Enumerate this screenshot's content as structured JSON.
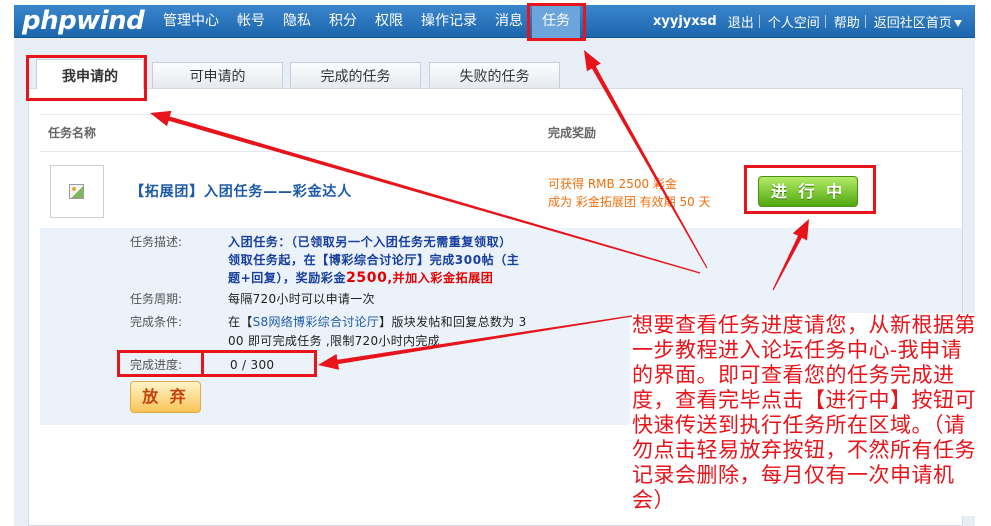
{
  "nav": {
    "logo": "phpwind",
    "items": [
      {
        "label": "管理中心"
      },
      {
        "label": "帐号"
      },
      {
        "label": "隐私"
      },
      {
        "label": "积分"
      },
      {
        "label": "权限"
      },
      {
        "label": "操作记录"
      },
      {
        "label": "消息"
      },
      {
        "label": "任务",
        "active": true
      }
    ],
    "user": "xyyjyxsd",
    "links": [
      "退出",
      "个人空间",
      "帮助",
      "返回社区首页"
    ],
    "dropdown_icon": "chevron-down-icon"
  },
  "tabs": [
    {
      "label": "我申请的",
      "active": true
    },
    {
      "label": "可申请的"
    },
    {
      "label": "完成的任务"
    },
    {
      "label": "失败的任务"
    }
  ],
  "table": {
    "col_name": "任务名称",
    "col_reward": "完成奖励"
  },
  "task": {
    "image_icon": "broken-image-icon",
    "title": "【拓展团】入团任务——彩金达人",
    "reward_line1": "可获得 RMB 2500 彩金",
    "reward_line2": "成为 彩金拓展团 有效期 50 天",
    "status_button": "进 行 中",
    "details": {
      "desc_label": "任务描述:",
      "desc_line1": "入团任务：（已领取另一个入团任务无需重复领取）",
      "desc_line2": "领取任务起，在【博彩综合讨论厅】完成300帖（主",
      "desc_line3": "题+回复），奖励彩金",
      "desc_amount": "2500",
      "desc_tail": ",并加入彩金拓展团",
      "cycle_label": "任务周期:",
      "cycle_value": "每隔720小时可以申请一次",
      "cond_label": "完成条件:",
      "cond_prefix": "在【",
      "cond_link": "S8网络博彩综合讨论厅",
      "cond_suffix": "】版块发帖和回复总数为 3",
      "cond_line2": "00 即可完成任务 ,限制720小时内完成",
      "progress_label": "完成进度:",
      "progress_value": "0 / 300",
      "abandon_button": "放 弃"
    }
  },
  "annotation": {
    "lines": [
      "想要查看任务进度请您，从新根据第",
      "一步教程进入论坛任务中心-我申请",
      "的界面。即可查看您的任务完成进",
      "度，查看完毕点击【进行中】按钮可",
      "快速传送到执行任务所在区域。（请",
      "勿点击轻易放弃按钮，不然所有任务",
      "记录会删除，每月仅有一次申请机",
      "会）"
    ]
  },
  "colors": {
    "nav_bg": "#1b66ad",
    "nav_active": "#6ba5dc",
    "link_blue": "#1d5aa8",
    "reward_orange": "#ee6f0c",
    "status_green": "#4fa80f",
    "annotation_red": "#e8141b"
  }
}
